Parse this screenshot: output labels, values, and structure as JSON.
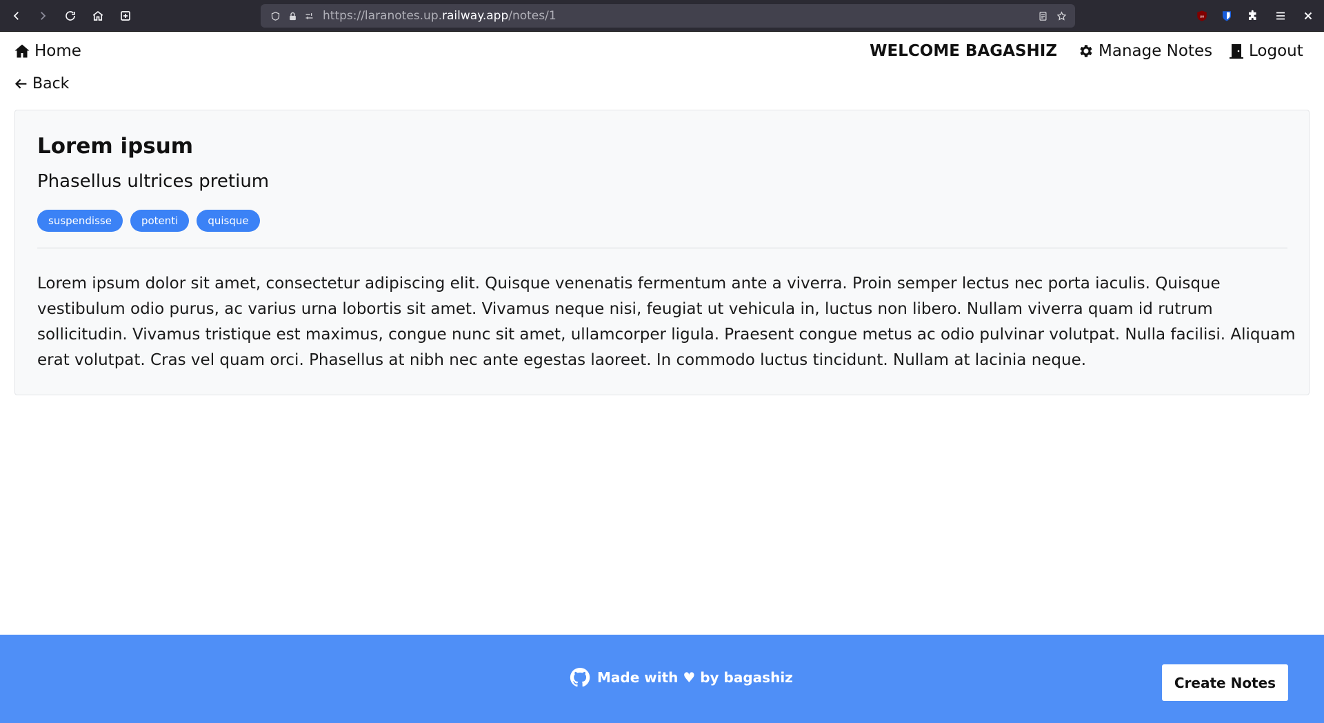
{
  "browser": {
    "url_prefix": "https://laranotes.up.",
    "url_host": "railway.app",
    "url_path": "/notes/1",
    "icons": [
      "back-icon",
      "forward-icon",
      "reload-icon",
      "home-icon",
      "new-tab-icon",
      "shield-icon",
      "lock-icon",
      "permissions-icon",
      "reader-view-icon",
      "bookmark-star-icon",
      "ublock-icon",
      "bitwarden-icon",
      "extensions-icon",
      "menu-icon",
      "close-icon"
    ]
  },
  "nav": {
    "home_label": "Home",
    "welcome_text": "WELCOME BAGASHIZ",
    "manage_label": "Manage Notes",
    "logout_label": "Logout",
    "back_label": "Back"
  },
  "note": {
    "title": "Lorem ipsum",
    "subtitle": "Phasellus ultrices pretium",
    "tags": [
      "suspendisse",
      "potenti",
      "quisque"
    ],
    "body": "Lorem ipsum dolor sit amet, consectetur adipiscing elit. Quisque venenatis fermentum ante a viverra. Proin semper lectus nec porta iaculis. Quisque vestibulum odio purus, ac varius urna lobortis sit amet. Vivamus neque nisi, feugiat ut vehicula in, luctus non libero. Nullam viverra quam id rutrum sollicitudin. Vivamus tristique est maximus, congue nunc sit amet, ullamcorper ligula. Praesent congue metus ac odio pulvinar volutpat. Nulla facilisi. Aliquam erat volutpat. Cras vel quam orci. Phasellus at nibh nec ante egestas laoreet. In commodo luctus tincidunt. Nullam at lacinia neque."
  },
  "footer": {
    "credit_text": "Made with ♥ by bagashiz",
    "create_button": "Create Notes"
  },
  "colors": {
    "accent": "#3b82f6",
    "footer_bg": "#4f8ff7",
    "browser_bg": "#2b2a33"
  }
}
